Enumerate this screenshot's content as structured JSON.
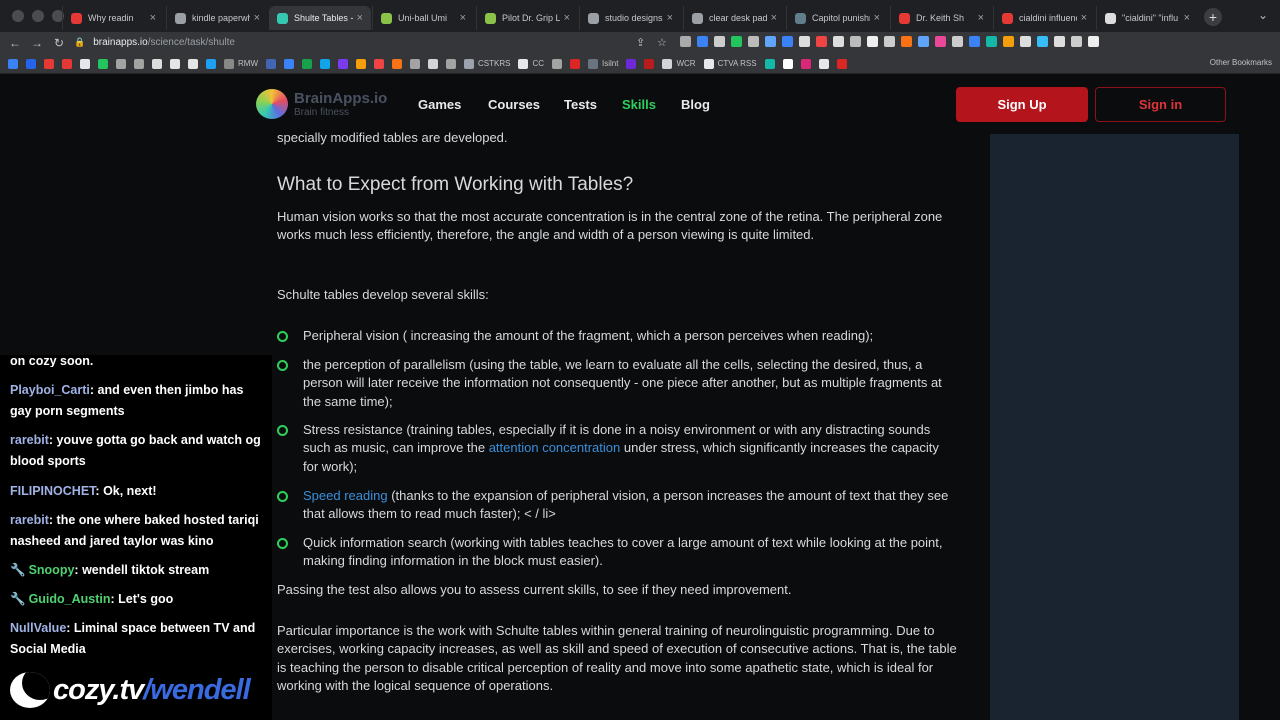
{
  "browser": {
    "tabs": [
      {
        "title": "Why readin",
        "color": "#e53935"
      },
      {
        "title": "kindle paperwh",
        "color": "#9aa0a6"
      },
      {
        "title": "Shulte Tables -",
        "color": "#35c9b1"
      },
      {
        "title": "Uni-ball Umi",
        "color": "#8bc34a"
      },
      {
        "title": "Pilot Dr. Grip Lit",
        "color": "#8bc34a"
      },
      {
        "title": "studio designs",
        "color": "#9aa0a6"
      },
      {
        "title": "clear desk pad",
        "color": "#9aa0a6"
      },
      {
        "title": "Capitol punishm",
        "color": "#607d8b"
      },
      {
        "title": "Dr. Keith Sh",
        "color": "#e53935"
      },
      {
        "title": "cialdini influenc",
        "color": "#e53935"
      },
      {
        "title": "\"cialdini\" \"influ",
        "color": "#dddddd"
      }
    ],
    "active_tab": 2,
    "url_host": "brainapps.io",
    "url_path": "/science/task/shulte",
    "bookmarks": [
      "RMW",
      "CSTKRS",
      "CC",
      "Isilnt",
      "WCR",
      "CTVA RSS"
    ],
    "other_bookmarks": "Other Bookmarks"
  },
  "site": {
    "logo_name": "BrainApps.io",
    "logo_tagline": "Brain fitness",
    "nav": [
      "Games",
      "Courses",
      "Tests",
      "Skills",
      "Blog"
    ],
    "active_nav": "Skills",
    "signup": "Sign Up",
    "signin": "Sign in"
  },
  "article": {
    "intro_tail": "specially modified tables are developed.",
    "heading": "What to Expect from Working with Tables?",
    "para1": "Human vision works so that the most accurate concentration is in the central zone of the retina. The peripheral zone works much less efficiently, therefore, the angle and width of a person viewing is quite limited.",
    "para2": "Schulte tables develop several skills:",
    "li1": "Peripheral vision ( increasing the amount of the fragment, which a person perceives when reading);",
    "li2": "the perception of parallelism (using the table, we learn to evaluate all the cells, selecting the desired, thus, a person will later receive the information not consequently - one piece after another, but as multiple fragments at the same time);",
    "li3_a": "Stress resistance (training tables, especially if it is done in a noisy environment or with any distracting sounds such as music, can improve the ",
    "li3_link": "attention concentration",
    "li3_b": " under stress, which significantly increases the capacity for work);",
    "li4_link": "Speed reading",
    "li4_b": " (thanks to the expansion of peripheral vision, a person increases the amount of text that they see that allows them to read much faster); < / li>",
    "li5": "Quick information search (working with tables teaches to cover a large amount of text while looking at the point, making finding information in the block must easier).",
    "para3": "Passing the test also allows you to assess current skills, to see if they need improvement.",
    "para4": "Particular importance is the work with Schulte tables within general training of neurolinguistic programming. Due to exercises, working capacity increases, as well as skill and speed of execution of consecutive actions. That is, the table is teaching the person to disable critical perception of reality and move into some apathetic state, which is ideal for working with the logical sequence of operations."
  },
  "chat": {
    "partial": "on cozy soon.",
    "messages": [
      {
        "user": "Playboi_Carti",
        "text": "and even then jimbo has gay porn segments"
      },
      {
        "user": "rarebit",
        "text": "youve gotta go back and watch og blood sports"
      },
      {
        "user": "FILIPINOCHET",
        "text": "Ok, next!"
      },
      {
        "user": "rarebit",
        "text": "the one where baked hosted tariqi nasheed and jared taylor was kino"
      },
      {
        "user": "Snoopy",
        "text": "wendell tiktok stream"
      },
      {
        "user": "Guido_Austin",
        "text": "Let's goo"
      },
      {
        "user": "NullValue",
        "text": "Liminal space between TV and Social Media"
      }
    ],
    "brand": "cozy.tv",
    "channel": "/wendell"
  }
}
